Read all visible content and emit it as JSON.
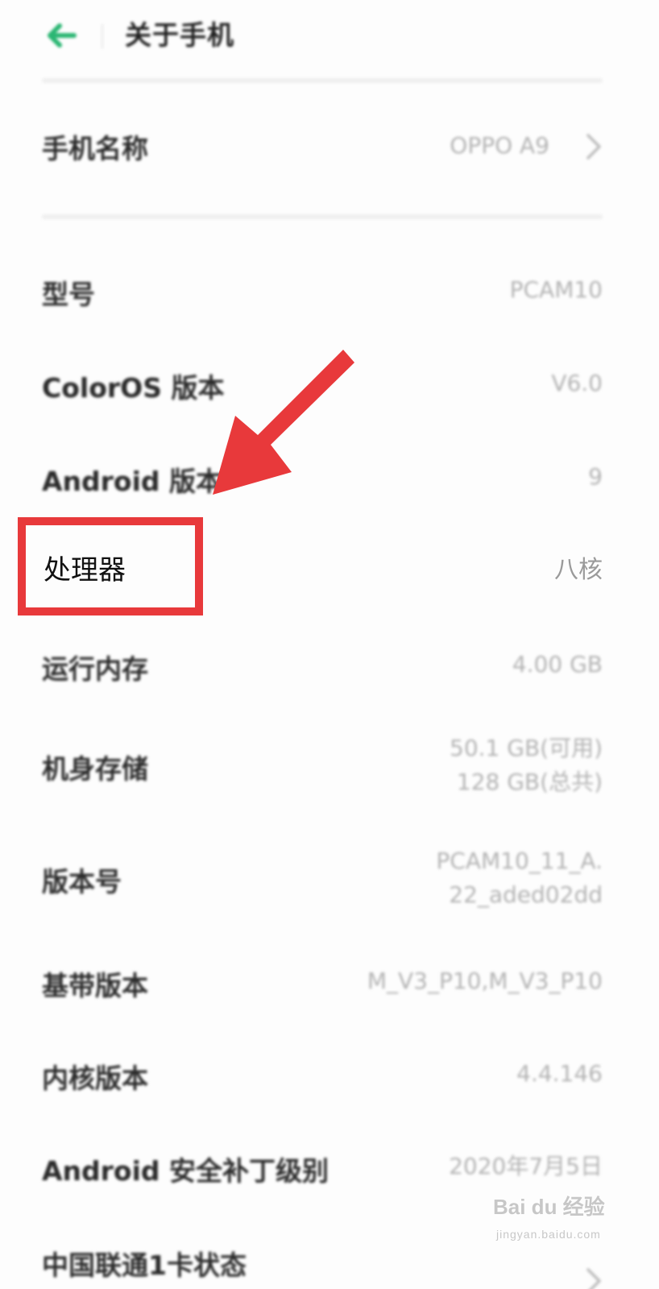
{
  "header": {
    "title": "关于手机",
    "back_icon": "arrow-left-icon",
    "accent_color": "#2bb673"
  },
  "device_name": {
    "label": "手机名称",
    "value": "OPPO A9"
  },
  "info_rows": [
    {
      "label": "型号",
      "value": "PCAM10"
    },
    {
      "label": "ColorOS 版本",
      "value": "V6.0"
    },
    {
      "label": "Android 版本",
      "value": "9"
    },
    {
      "label": "处理器",
      "value": "八核"
    },
    {
      "label": "运行内存",
      "value": "4.00 GB"
    },
    {
      "label": "机身存储",
      "value_line1": "50.1 GB(可用)",
      "value_line2": "128 GB(总共)"
    },
    {
      "label": "版本号",
      "value_line1": "PCAM10_11_A.",
      "value_line2": "22_aded02dd"
    },
    {
      "label": "基带版本",
      "value": "M_V3_P10,M_V3_P10"
    },
    {
      "label": "内核版本",
      "value": "4.4.146"
    },
    {
      "label": "Android 安全补丁级别",
      "value": "2020年7月5日"
    },
    {
      "label": "中国联通1卡状态"
    }
  ],
  "annotation": {
    "highlight_color": "#e8393b",
    "arrow_icon": "red-arrow-icon"
  },
  "watermark": {
    "main": "Bai du 经验",
    "sub": "jingyan.baidu.com"
  }
}
